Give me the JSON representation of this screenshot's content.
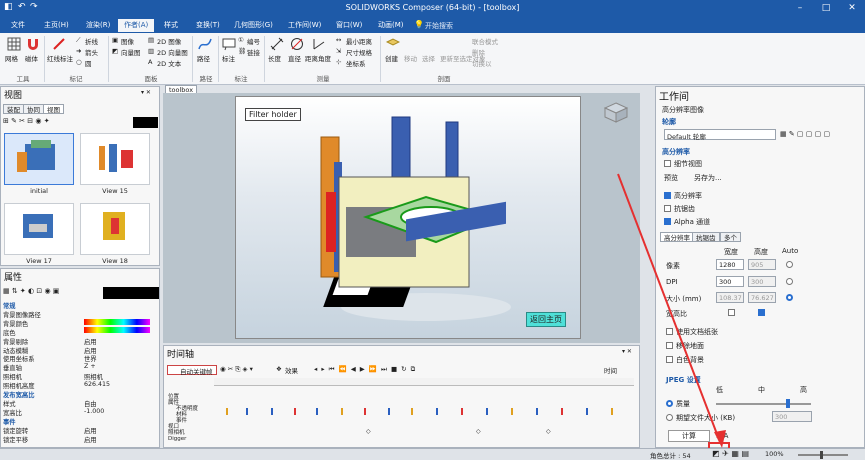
{
  "titlebar": {
    "title": "SOLIDWORKS Composer (64-bit) - [toolbox]"
  },
  "menus": [
    "文件",
    "主页(H)",
    "渲染(R)",
    "作者(A)",
    "样式",
    "变换(T)",
    "几何图形(G)",
    "工作间(W)",
    "窗口(W)",
    "动画(M)"
  ],
  "search": {
    "placeholder": "开始搜索"
  },
  "ribbon": {
    "tools": {
      "a": "网格",
      "b": "磁体",
      "group": "工具"
    },
    "marks": {
      "a": "红线标注",
      "b": "折线",
      "c": "箭头",
      "d": "圆",
      "group": "标记"
    },
    "panel": {
      "a": "图像",
      "b": "向量图",
      "c": "2D 图像",
      "d": "2D 向量图",
      "e": "2D 文本",
      "group": "面板"
    },
    "path": {
      "a": "路径",
      "group": "路径"
    },
    "annot": {
      "a": "标注",
      "b": "编号",
      "c": "链接",
      "group": "标注"
    },
    "measure": {
      "a": "长度",
      "b": "直径",
      "c": "距离角度",
      "d": "最小距离",
      "e": "尺寸规格",
      "f": "坐标系",
      "group": "测量"
    },
    "cut": {
      "a": "创建",
      "b": "移动",
      "c": "选择",
      "d": "更新至选定对象",
      "e": "联合模式",
      "f": "删除",
      "g": "切换以",
      "group": "剖面"
    }
  },
  "views_panel": {
    "title": "视图",
    "tabs": [
      "装配",
      "协同",
      "视图"
    ],
    "thumbs": [
      "initial",
      "View 15",
      "View 17",
      "View 18"
    ]
  },
  "props_panel": {
    "title": "属性",
    "rows": [
      {
        "k": "常规",
        "v": "",
        "sec": true
      },
      {
        "k": "背景图像路径",
        "v": ""
      },
      {
        "k": "背景颜色",
        "v": ""
      },
      {
        "k": "底色",
        "v": ""
      },
      {
        "k": "背景剔除",
        "v": "启用"
      },
      {
        "k": "动态模糊",
        "v": "启用"
      },
      {
        "k": "使用坐标系",
        "v": "世界"
      },
      {
        "k": "垂直轴",
        "v": "Z +"
      },
      {
        "k": "照相机",
        "v": "照相机"
      },
      {
        "k": "照相机高度",
        "v": "626.415"
      },
      {
        "k": "发布宽高比",
        "v": "",
        "sec": true
      },
      {
        "k": "样式",
        "v": "自由"
      },
      {
        "k": "宽高比",
        "v": "-1.000"
      },
      {
        "k": "事件",
        "v": "",
        "sec": true
      },
      {
        "k": "锁定旋转",
        "v": "启用"
      },
      {
        "k": "锁定平移",
        "v": "启用"
      }
    ]
  },
  "viewport": {
    "tab": "toolbox",
    "label": "Filter holder",
    "button": "返回主页"
  },
  "timeline": {
    "title": "时间轴",
    "autokey": "自动关键帧",
    "effects": "效果",
    "time": "时间",
    "rows": [
      "位置",
      "属性",
      "不透明度",
      "材料",
      "事件",
      "视口",
      "照相机",
      "Digger"
    ]
  },
  "workshop": {
    "title": "工作间",
    "subtitle": "高分辨率图像",
    "profile_label": "轮廓",
    "profile_value": "Default 轮廓",
    "hires": "高分辨率",
    "detail_view": "细节视图",
    "preview": "预览",
    "save_as": "另存为...",
    "cb_hires": "高分辨率",
    "cb_aa": "抗锯齿",
    "cb_alpha": "Alpha 通道",
    "tabs": [
      "高分辨率",
      "抗锯齿",
      "多个"
    ],
    "col_w": "宽度",
    "col_h": "高度",
    "col_auto": "Auto",
    "r_px": "像素",
    "r_dpi": "DPI",
    "r_mm": "大小 (mm)",
    "px_w": "1280",
    "px_h": "905",
    "dpi_w": "300",
    "dpi_h": "300",
    "mm_w": "108.37",
    "mm_h": "76.627",
    "aspect": "宽高比",
    "cb_doc_paper": "使用文档纸张",
    "cb_ground": "移除地面",
    "cb_white": "白色背景",
    "jpeg": "JPEG 设置",
    "low": "低",
    "mid": "中",
    "high": "高",
    "quality": "质量",
    "target": "期望文件大小 (KB)",
    "target_val": "300",
    "compute": "计算",
    "na": "N/A"
  },
  "statusbar": {
    "count": "角色总计 : 54",
    "zoom": "100%"
  },
  "colors": {
    "accent": "#1e5aa8",
    "red_arrow": "#e53030"
  }
}
